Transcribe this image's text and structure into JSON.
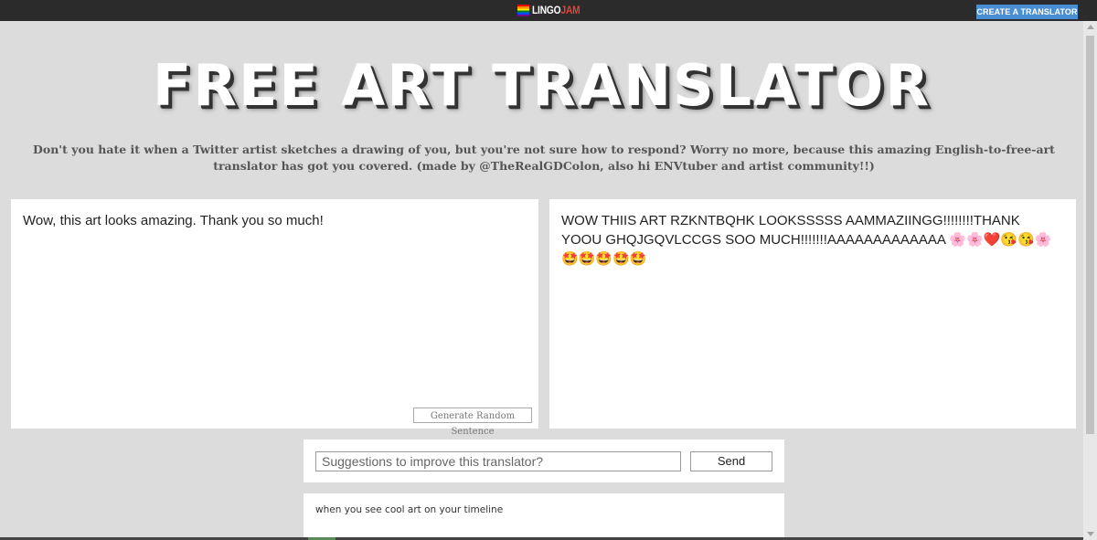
{
  "header": {
    "logo_part1": "LINGO",
    "logo_part2": "JAM",
    "create_button": "CREATE A TRANSLATOR"
  },
  "page": {
    "title": "FREE ART TRANSLATOR",
    "description": "Don't you hate it when a Twitter artist sketches a drawing of you, but you're not sure how to respond? Worry no more, because this amazing English-to-free-art translator has got you covered. (made by @TheRealGDColon, also hi ENVtuber and artist community!!)"
  },
  "translator": {
    "input_text": "Wow, this art looks amazing. Thank you so much!",
    "random_button": "Generate Random Sentence",
    "output_text": "WOW THIIS ART RZKNTBQHK LOOKSSSSS AAMMAZIINGG!!!!!!!!THANK YOOU GHQJGQVLCCGS SOO MUCH!!!!!!!AAAAAAAAAAAAA 🌸🌸❤️😘😘🌸🤩🤩🤩🤩🤩"
  },
  "suggestions": {
    "placeholder": "Suggestions to improve this translator?",
    "send_button": "Send"
  },
  "caption": {
    "text": "when you see cool art on your timeline"
  },
  "colors": {
    "background": "#dcdcdc",
    "topbar": "#2b2b2b",
    "accent_button": "#4a8fd4",
    "logo_accent": "#e0463c"
  }
}
